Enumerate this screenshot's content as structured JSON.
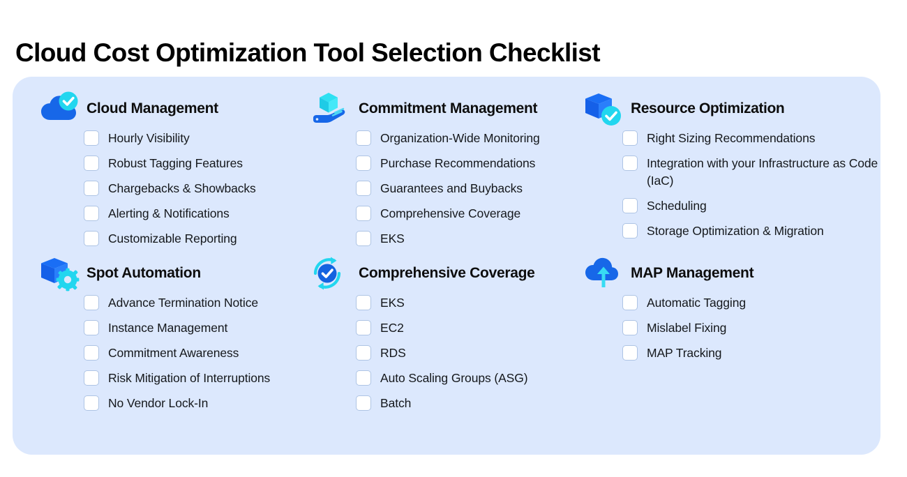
{
  "title": "Cloud Cost Optimization Tool Selection Checklist",
  "colors": {
    "card_background": "#dce8fd",
    "page_background": "#ffffff",
    "icon_blue": "#1a6ef5",
    "icon_blue_dark": "#1560e8",
    "icon_cyan": "#22d6ef",
    "checkbox_border": "#aec4e4",
    "checkbox_fill": "#ffffff",
    "text": "#15181c"
  },
  "sections": [
    {
      "icon": "cloud-check-icon",
      "title": "Cloud Management",
      "items": [
        "Hourly Visibility",
        "Robust Tagging Features",
        "Chargebacks & Showbacks",
        "Alerting & Notifications",
        "Customizable Reporting"
      ]
    },
    {
      "icon": "hand-holding-cube-icon",
      "title": "Commitment Management",
      "items": [
        "Organization-Wide Monitoring",
        "Purchase Recommendations",
        "Guarantees and Buybacks",
        "Comprehensive Coverage",
        "EKS"
      ]
    },
    {
      "icon": "box-check-icon",
      "title": "Resource Optimization",
      "items": [
        "Right Sizing Recommendations",
        "Integration with your Infrastructure as Code (IaC)",
        "Scheduling",
        "Storage Optimization & Migration"
      ]
    },
    {
      "icon": "box-gear-icon",
      "title": "Spot Automation",
      "items": [
        "Advance Termination Notice",
        "Instance Management",
        "Commitment Awareness",
        "Risk Mitigation of Interruptions",
        "No Vendor Lock-In"
      ]
    },
    {
      "icon": "check-circle-refresh-icon",
      "title": "Comprehensive Coverage",
      "items": [
        "EKS",
        "EC2",
        "RDS",
        "Auto Scaling Groups (ASG)",
        "Batch"
      ]
    },
    {
      "icon": "cloud-upload-icon",
      "title": "MAP Management",
      "items": [
        "Automatic Tagging",
        "Mislabel Fixing",
        "MAP Tracking"
      ]
    }
  ]
}
